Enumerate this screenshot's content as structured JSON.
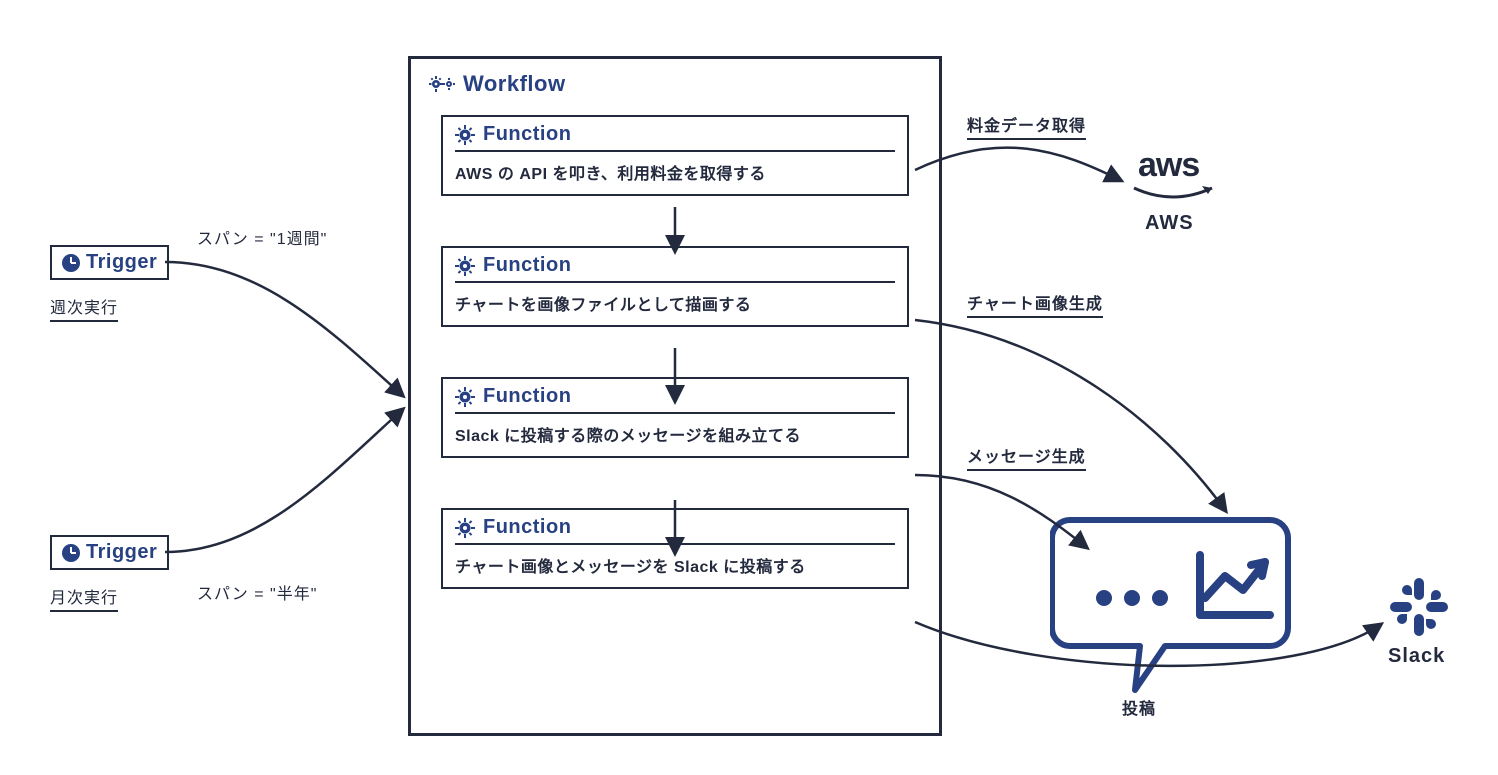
{
  "workflow": {
    "title": "Workflow"
  },
  "triggers": [
    {
      "title": "Trigger",
      "caption": "週次実行",
      "span_label": "スパン = \"1週間\""
    },
    {
      "title": "Trigger",
      "caption": "月次実行",
      "span_label": "スパン = \"半年\""
    }
  ],
  "functions": [
    {
      "title": "Function",
      "desc": "AWS の API を叩き、利用料金を取得する"
    },
    {
      "title": "Function",
      "desc": "チャートを画像ファイルとして描画する"
    },
    {
      "title": "Function",
      "desc": "Slack に投稿する際のメッセージを組み立てる"
    },
    {
      "title": "Function",
      "desc": "チャート画像とメッセージを Slack に投稿する"
    }
  ],
  "edges": {
    "fetch": "料金データ取得",
    "chart": "チャート画像生成",
    "message": "メッセージ生成",
    "post": "投稿"
  },
  "external": {
    "aws": "AWS",
    "slack": "Slack"
  }
}
